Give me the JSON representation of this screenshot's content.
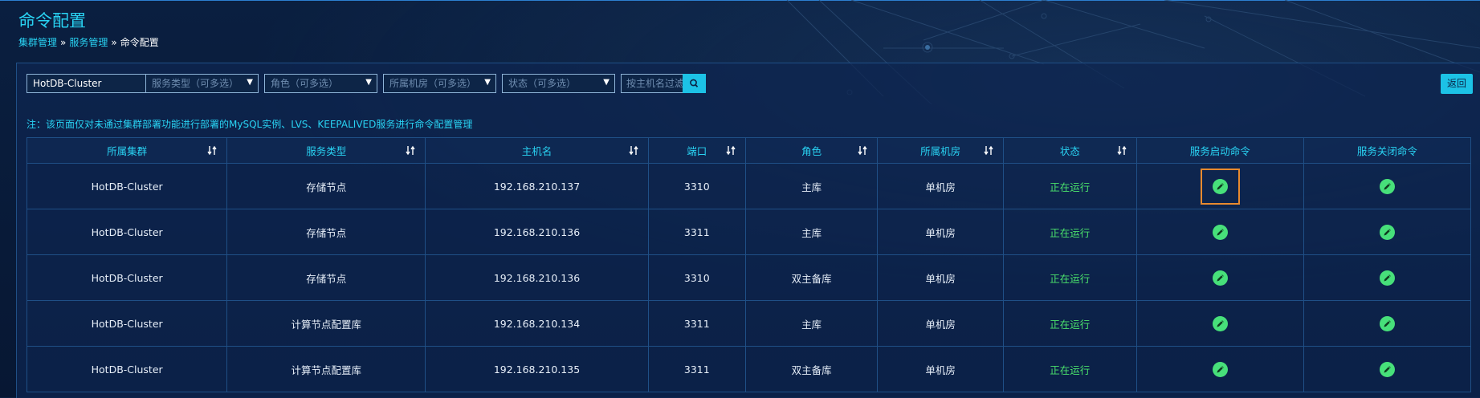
{
  "page": {
    "title": "命令配置",
    "breadcrumb": [
      "集群管理",
      "服务管理",
      "命令配置"
    ],
    "breadcrumb_sep": "»"
  },
  "filters": {
    "cluster": "HotDB-Cluster",
    "service_type_placeholder": "服务类型（可多选）",
    "role_placeholder": "角色（可多选）",
    "room_placeholder": "所属机房（可多选）",
    "status_placeholder": "状态（可多选）",
    "host_filter_placeholder": "按主机名过滤"
  },
  "back_label": "返回",
  "note": "注：该页面仅对未通过集群部署功能进行部署的MySQL实例、LVS、KEEPALIVED服务进行命令配置管理",
  "table": {
    "headers": [
      "所属集群",
      "服务类型",
      "主机名",
      "端口",
      "角色",
      "所属机房",
      "状态",
      "服务启动命令",
      "服务关闭命令"
    ],
    "rows": [
      {
        "cluster": "HotDB-Cluster",
        "type": "存储节点",
        "host": "192.168.210.137",
        "port": "3310",
        "role": "主库",
        "room": "单机房",
        "status": "正在运行"
      },
      {
        "cluster": "HotDB-Cluster",
        "type": "存储节点",
        "host": "192.168.210.136",
        "port": "3311",
        "role": "主库",
        "room": "单机房",
        "status": "正在运行"
      },
      {
        "cluster": "HotDB-Cluster",
        "type": "存储节点",
        "host": "192.168.210.136",
        "port": "3310",
        "role": "双主备库",
        "room": "单机房",
        "status": "正在运行"
      },
      {
        "cluster": "HotDB-Cluster",
        "type": "计算节点配置库",
        "host": "192.168.210.134",
        "port": "3311",
        "role": "主库",
        "room": "单机房",
        "status": "正在运行"
      },
      {
        "cluster": "HotDB-Cluster",
        "type": "计算节点配置库",
        "host": "192.168.210.135",
        "port": "3311",
        "role": "双主备库",
        "room": "单机房",
        "status": "正在运行"
      }
    ]
  },
  "icons": {
    "edit": "pencil-icon",
    "sort": "sort-icon",
    "search": "search-icon",
    "caret": "caret-down-icon"
  },
  "colors": {
    "accent": "#29d3f3",
    "running": "#4be36c",
    "edit_button": "#47e07a",
    "highlight": "#e88a2e",
    "background": "#081a36"
  }
}
